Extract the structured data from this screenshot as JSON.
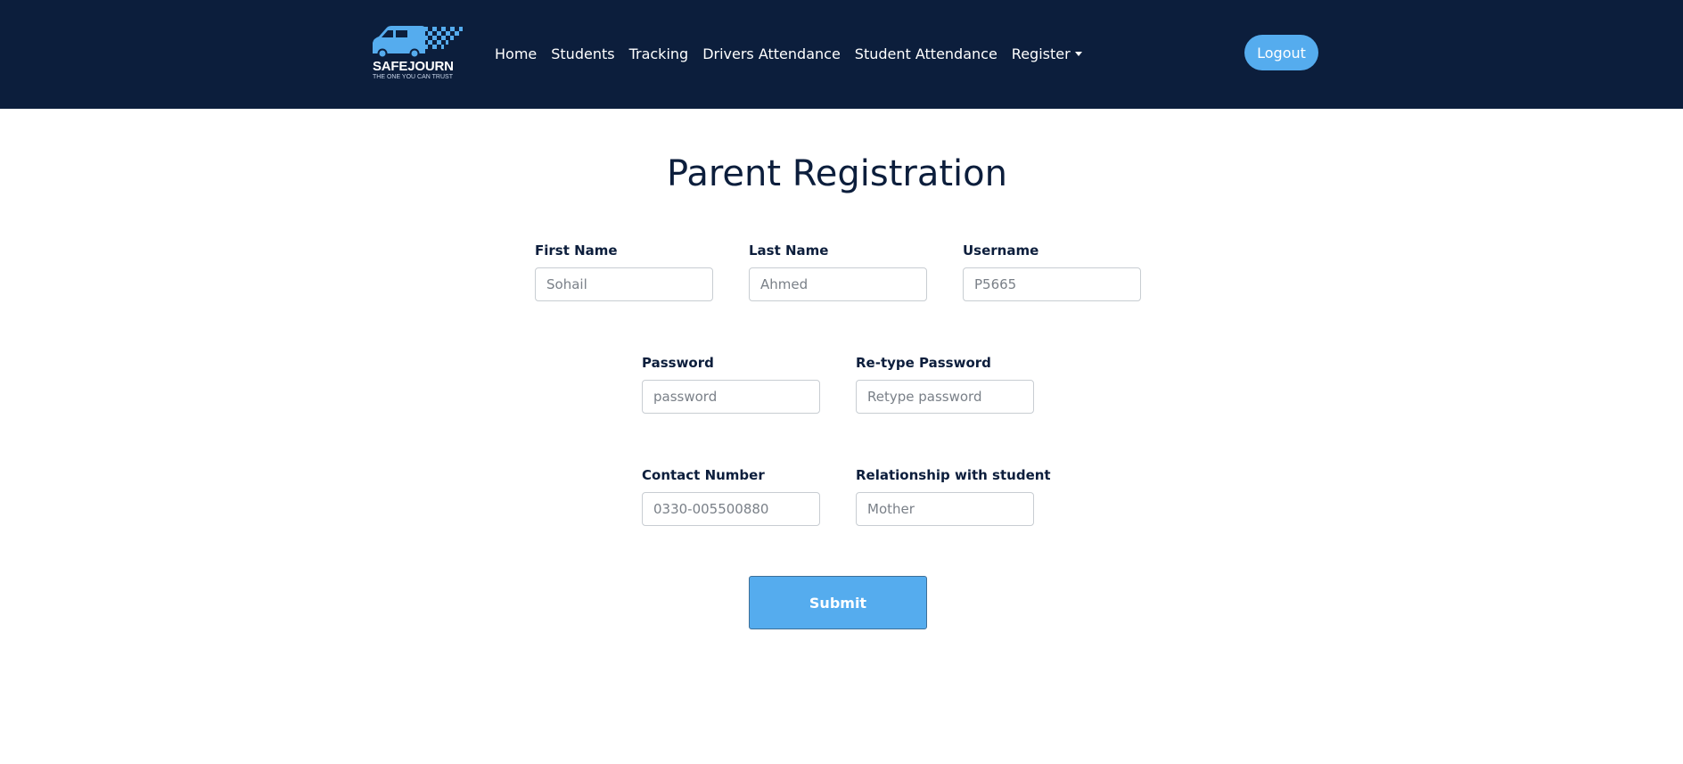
{
  "brand": {
    "name": "SAFEJOURN",
    "tagline": "THE ONE YOU CAN TRUST"
  },
  "nav": {
    "items": [
      {
        "label": "Home"
      },
      {
        "label": "Students"
      },
      {
        "label": "Tracking"
      },
      {
        "label": "Drivers Attendance"
      },
      {
        "label": "Student Attendance"
      },
      {
        "label": "Register",
        "has_dropdown": true
      }
    ],
    "logout_label": "Logout"
  },
  "page": {
    "title": "Parent Registration"
  },
  "form": {
    "first_name": {
      "label": "First Name",
      "placeholder": "Sohail"
    },
    "last_name": {
      "label": "Last Name",
      "placeholder": "Ahmed"
    },
    "username": {
      "label": "Username",
      "placeholder": "P5665"
    },
    "password": {
      "label": "Password",
      "placeholder": "password"
    },
    "retype_password": {
      "label": "Re-type Password",
      "placeholder": "Retype password"
    },
    "contact_number": {
      "label": "Contact Number",
      "placeholder": "0330-005500880"
    },
    "relationship": {
      "label": "Relationship with student",
      "placeholder": "Mother"
    },
    "submit_label": "Submit"
  },
  "colors": {
    "navbar_bg": "#0c1e3c",
    "accent": "#55acee",
    "text_dark": "#0c1e3c"
  }
}
